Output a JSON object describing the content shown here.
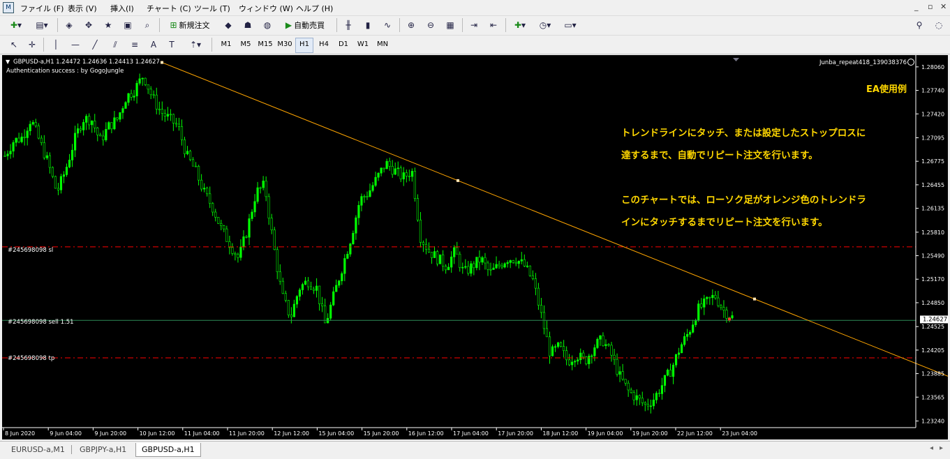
{
  "menu": [
    "ファイル (F)",
    "表示 (V)",
    "挿入(I)",
    "チャート (C)",
    "ツール (T)",
    "ウィンドウ (W)",
    "ヘルプ (H)"
  ],
  "toolbar": {
    "new_order_label": "新規注文",
    "auto_trade_label": "自動売買"
  },
  "timeframes": [
    "M1",
    "M5",
    "M15",
    "M30",
    "H1",
    "H4",
    "D1",
    "W1",
    "MN"
  ],
  "active_timeframe": "H1",
  "chart": {
    "symbol_info": "GBPUSD-a,H1  1.24472 1.24636 1.24413 1.24627",
    "auth_text": "Authentication success : by GogoJungle",
    "ea_name": "Junba_repeat418_139038376",
    "annotation_title": "EA使用例",
    "annotation_lines": [
      "トレンドラインにタッチ、または設定したストップロスに",
      "達するまで、自動でリピート注文を行います。",
      "",
      "このチャートでは、ローソク足がオレンジ色のトレンドラ",
      "インにタッチするまでリピート注文を行います。"
    ],
    "sl_label": "#245698098 sl",
    "sell_label": "#245698098 sell 1.51",
    "tp_label": "#245698098 tp",
    "current_price_label": "1.24627",
    "colors": {
      "bull": "#00ff00",
      "annotation": "#ffd700",
      "trendline": "#ffa500",
      "sl_tp": "#ff0000",
      "sell": "#2e8b57"
    }
  },
  "chart_data": {
    "type": "candlestick",
    "symbol": "GBPUSD-a",
    "timeframe": "H1",
    "ylim": [
      1.2315,
      1.2822
    ],
    "y_ticks": [
      "1.28060",
      "1.27740",
      "1.27420",
      "1.27095",
      "1.26775",
      "1.26455",
      "1.26135",
      "1.25810",
      "1.25490",
      "1.25170",
      "1.24850",
      "1.24525",
      "1.24205",
      "1.23885",
      "1.23565",
      "1.23240"
    ],
    "x_ticks": [
      "8 Jun 2020",
      "9 Jun 04:00",
      "9 Jun 20:00",
      "10 Jun 12:00",
      "11 Jun 04:00",
      "11 Jun 20:00",
      "12 Jun 12:00",
      "15 Jun 04:00",
      "15 Jun 20:00",
      "16 Jun 12:00",
      "17 Jun 04:00",
      "17 Jun 20:00",
      "18 Jun 12:00",
      "19 Jun 04:00",
      "19 Jun 20:00",
      "22 Jun 12:00",
      "23 Jun 04:00"
    ],
    "price_path": [
      1.2685,
      1.2705,
      1.271,
      1.2735,
      1.2705,
      1.2675,
      1.2635,
      1.2665,
      1.2705,
      1.2735,
      1.2735,
      1.2705,
      1.2725,
      1.2735,
      1.2765,
      1.2775,
      1.2795,
      1.2765,
      1.2745,
      1.2735,
      1.2725,
      1.2685,
      1.2665,
      1.2635,
      1.2615,
      1.2585,
      1.2565,
      1.2545,
      1.2585,
      1.2635,
      1.2645,
      1.2565,
      1.2495,
      1.2465,
      1.2505,
      1.2515,
      1.2505,
      1.2455,
      1.2495,
      1.2535,
      1.2575,
      1.2625,
      1.2635,
      1.2655,
      1.2675,
      1.2665,
      1.2655,
      1.2665,
      1.2575,
      1.2555,
      1.2545,
      1.2535,
      1.2555,
      1.2525,
      1.2535,
      1.2545,
      1.2525,
      1.2535,
      1.2545,
      1.2545,
      1.2535,
      1.2515,
      1.2465,
      1.2415,
      1.2425,
      1.2405,
      1.2415,
      1.2405,
      1.2425,
      1.2435,
      1.2415,
      1.2385,
      1.2365,
      1.2355,
      1.2345,
      1.2355,
      1.2375,
      1.2395,
      1.2425,
      1.2445,
      1.2475,
      1.2485,
      1.2495,
      1.2475,
      1.2465
    ],
    "lines": {
      "trendline": [
        {
          "x": "10 Jun 12:00",
          "y": 1.2812
        },
        {
          "x": "after 23 Jun 04:00",
          "y": 1.2385
        }
      ],
      "sl": 1.2561,
      "sell": 1.2461,
      "tp": 1.241,
      "current_price": 1.24627
    }
  }
}
